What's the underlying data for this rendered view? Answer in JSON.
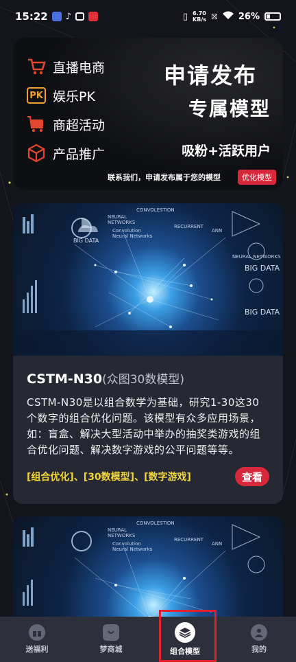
{
  "status_bar": {
    "time": "15:22",
    "net_speed_value": "6.70",
    "net_speed_unit": "KB/s",
    "battery": "26%"
  },
  "promo": {
    "items": [
      {
        "label": "直播电商",
        "icon": "cart-icon"
      },
      {
        "label": "娱乐PK",
        "icon": "pk-icon",
        "icon_text": "PK"
      },
      {
        "label": "商超活动",
        "icon": "shopping-cart-icon"
      },
      {
        "label": "产品推广",
        "icon": "cube-icon"
      }
    ],
    "headline1": "申请发布",
    "headline2": "专属模型",
    "headline3": "吸粉+活跃用户",
    "footer": "联系我们，申请发布属于您的模型",
    "tag": "优化模型"
  },
  "cards": [
    {
      "image_texts": [
        "CONVOLESTION",
        "NEURAL",
        "NETWORKS",
        "Convolution",
        "Neural Networks",
        "RECURRENT",
        "NEURAL NETWORKS",
        "ANN",
        "BIG DATA",
        "BIG DATA",
        "BIG DATA"
      ],
      "title": "CSTM-N30",
      "subtitle": "(众图30数模型)",
      "description": "CSTM-N30是以组合数学为基础，研究1-30这30个数字的组合优化问题。该模型有众多应用场景，如：盲盒、解决大型活动中举办的抽奖类游戏的组合优化问题、解决数字游戏的公平问题等等。",
      "tags": "[组合优化]、[30数模型]、[数字游戏]",
      "button": "查看"
    },
    {
      "image_texts": [
        "CONVOLESTION",
        "NEURAL",
        "NETWORKS",
        "Convolution",
        "Neural Networks",
        "RECURRENT",
        "ANN"
      ]
    }
  ],
  "nav": {
    "items": [
      {
        "label": "送福利",
        "icon": "gift-icon"
      },
      {
        "label": "梦商城",
        "icon": "shop-bag-icon"
      },
      {
        "label": "组合模型",
        "icon": "layers-icon"
      },
      {
        "label": "我的",
        "icon": "user-icon"
      }
    ],
    "active_index": 2
  },
  "colors": {
    "background": "#14151c",
    "card": "#262833",
    "accent_red": "#d8283c",
    "tag_yellow": "#f2d53c",
    "promo_icon": "#e3472f",
    "nav_bg": "#2d2f3a"
  }
}
